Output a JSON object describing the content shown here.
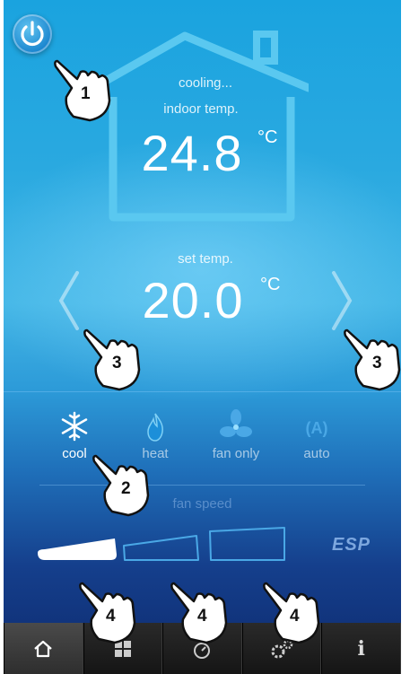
{
  "status": {
    "state": "cooling...",
    "indoor_label": "indoor temp.",
    "indoor_value": "24.8",
    "unit": "°C"
  },
  "setpoint": {
    "label": "set temp.",
    "value": "20.0",
    "unit": "°C"
  },
  "modes": [
    {
      "name": "cool",
      "icon": "snowflake-icon",
      "active": true
    },
    {
      "name": "heat",
      "icon": "flame-icon",
      "active": false
    },
    {
      "name": "fan only",
      "icon": "fan-icon",
      "active": false
    },
    {
      "name": "auto",
      "icon": "auto-icon",
      "active": false
    }
  ],
  "fan": {
    "label": "fan speed",
    "esp_label": "ESP"
  },
  "tabs": [
    {
      "icon": "home-icon",
      "active": true
    },
    {
      "icon": "grid-icon",
      "active": false
    },
    {
      "icon": "timer-icon",
      "active": false
    },
    {
      "icon": "settings-icon",
      "active": false
    },
    {
      "icon": "info-icon",
      "label": "i",
      "active": false
    }
  ],
  "callouts": {
    "power": "1",
    "mode": "2",
    "left": "3",
    "right": "3",
    "speed1": "4",
    "speed2": "4",
    "speed3": "4"
  },
  "colors": {
    "accent": "#2aa9e0",
    "dark": "#0d2a6e"
  }
}
